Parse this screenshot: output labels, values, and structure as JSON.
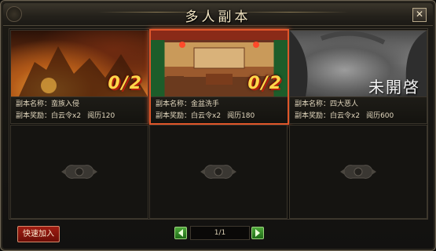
{
  "window": {
    "title": "多人副本",
    "close_symbol": "✕"
  },
  "slots": [
    {
      "state": "open",
      "count": "0/2",
      "name_label": "副本名称：",
      "name": "蛮族入侵",
      "reward_label": "副本奖励：",
      "reward": "白云令x2",
      "exp": "阅历120",
      "active": false,
      "scene": "orange-ruins"
    },
    {
      "state": "open",
      "count": "0/2",
      "name_label": "副本名称：",
      "name": "金盆洗手",
      "reward_label": "副本奖励：",
      "reward": "白云令x2",
      "exp": "阅历180",
      "active": true,
      "scene": "hall-interior"
    },
    {
      "state": "locked",
      "locked_text": "未開啓",
      "name_label": "副本名称：",
      "name": "四大恶人",
      "reward_label": "副本奖励：",
      "reward": "白云令x2",
      "exp": "阅历600",
      "active": false,
      "scene": "grey-forest"
    }
  ],
  "empty_slots": 3,
  "footer": {
    "quick_join": "快速加入",
    "page": "1/1",
    "prev_icon": "left-arrow-icon",
    "next_icon": "right-arrow-icon"
  },
  "colors": {
    "accent": "#e0562a",
    "count": "#ffd84a",
    "button_red": "#a01d12",
    "pager_green": "#4da83a"
  }
}
